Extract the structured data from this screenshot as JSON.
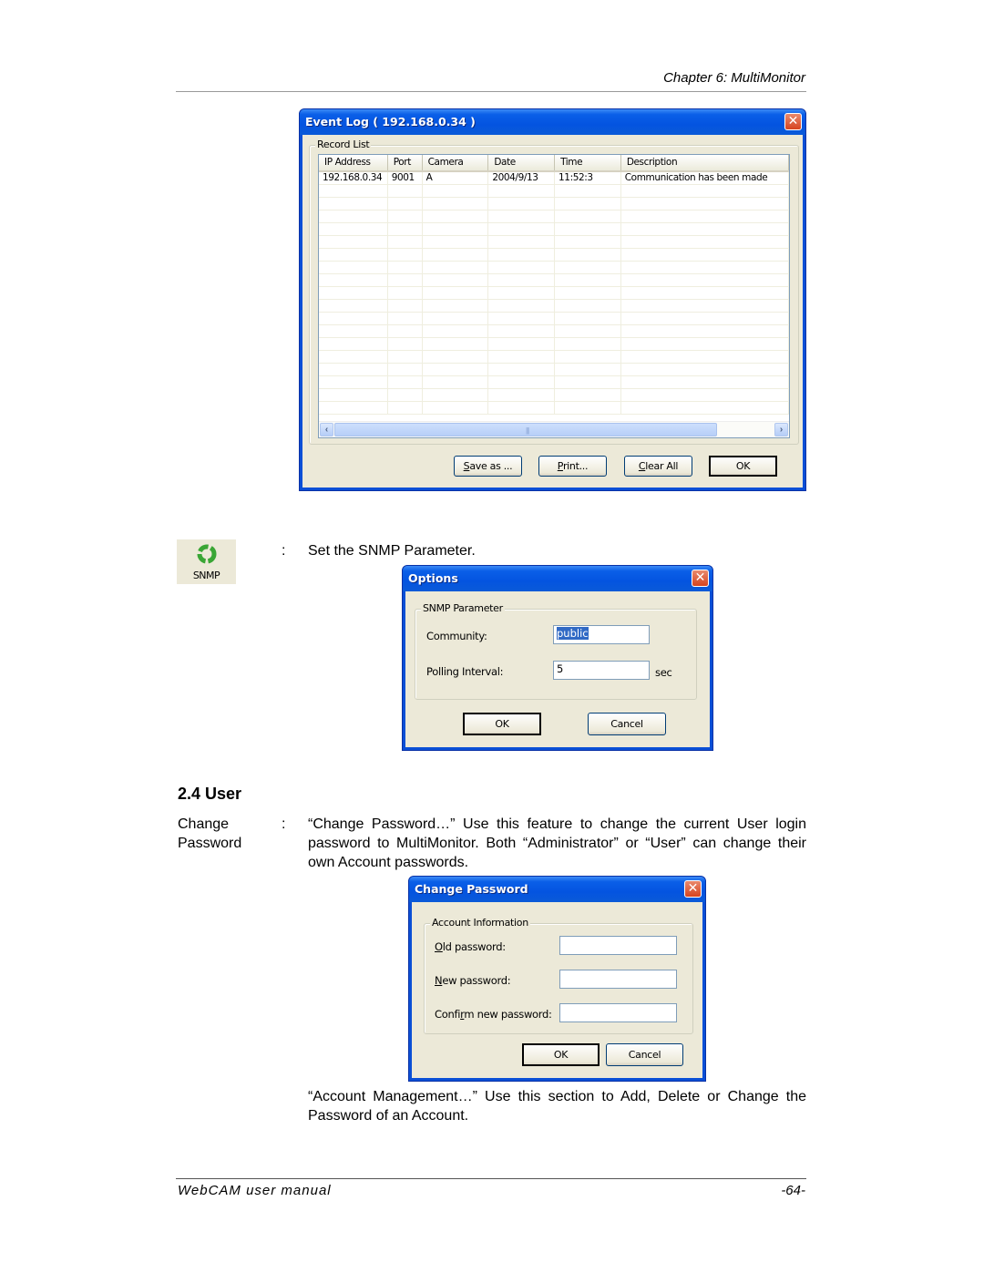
{
  "page": {
    "chapter_header": "Chapter 6: MultiMonitor",
    "footer_title": "WebCAM  user  manual",
    "page_number": "-64-"
  },
  "event_log": {
    "title": "Event Log ( 192.168.0.34 )",
    "group_label": "Record List",
    "columns": [
      "IP Address",
      "Port",
      "Camera",
      "Date",
      "Time",
      "Description"
    ],
    "rows": [
      [
        "192.168.0.34",
        "9001",
        "A",
        "2004/9/13",
        "11:52:3",
        "Communication has been made"
      ]
    ],
    "buttons": {
      "save_as": {
        "mnemonic": "S",
        "rest": "ave as ..."
      },
      "print": {
        "mnemonic": "P",
        "rest": "rint..."
      },
      "clear_all": {
        "mnemonic": "C",
        "rest": "lear All"
      },
      "ok": "OK"
    }
  },
  "snmp": {
    "icon_label": "SNMP",
    "colon": ":",
    "description": "Set the SNMP Parameter.",
    "dialog": {
      "title": "Options",
      "group_label": "SNMP Parameter",
      "community_label": "Community:",
      "community_value": "public",
      "polling_label": "Polling Interval:",
      "polling_value": "5",
      "polling_unit": "sec",
      "ok": "OK",
      "cancel": "Cancel"
    }
  },
  "user_section": {
    "heading": "2.4 User",
    "change_password": {
      "term_line1": "Change",
      "term_line2": "Password",
      "colon": ":",
      "description": "“Change Password…”  Use this feature to change the current User login password to MultiMonitor.  Both “Administrator” or “User” can change their own Account passwords."
    },
    "dialog": {
      "title": "Change Password",
      "group_label": "Account Information",
      "old_label": {
        "mnemonic": "O",
        "rest": "ld password:"
      },
      "new_label": {
        "mnemonic": "N",
        "rest": "ew password:"
      },
      "confirm_label": {
        "before": "Confi",
        "mnemonic": "r",
        "rest": "m new password:"
      },
      "old_value": "",
      "new_value": "",
      "confirm_value": "",
      "ok": "OK",
      "cancel": "Cancel"
    },
    "account_management": "“Account Management…”  Use this section to Add, Delete or Change the Password of an Account."
  },
  "colors": {
    "xp_title_blue": "#0454e0",
    "xp_face": "#ece9d8",
    "selection": "#316ac5",
    "close_red": "#d6441f"
  }
}
